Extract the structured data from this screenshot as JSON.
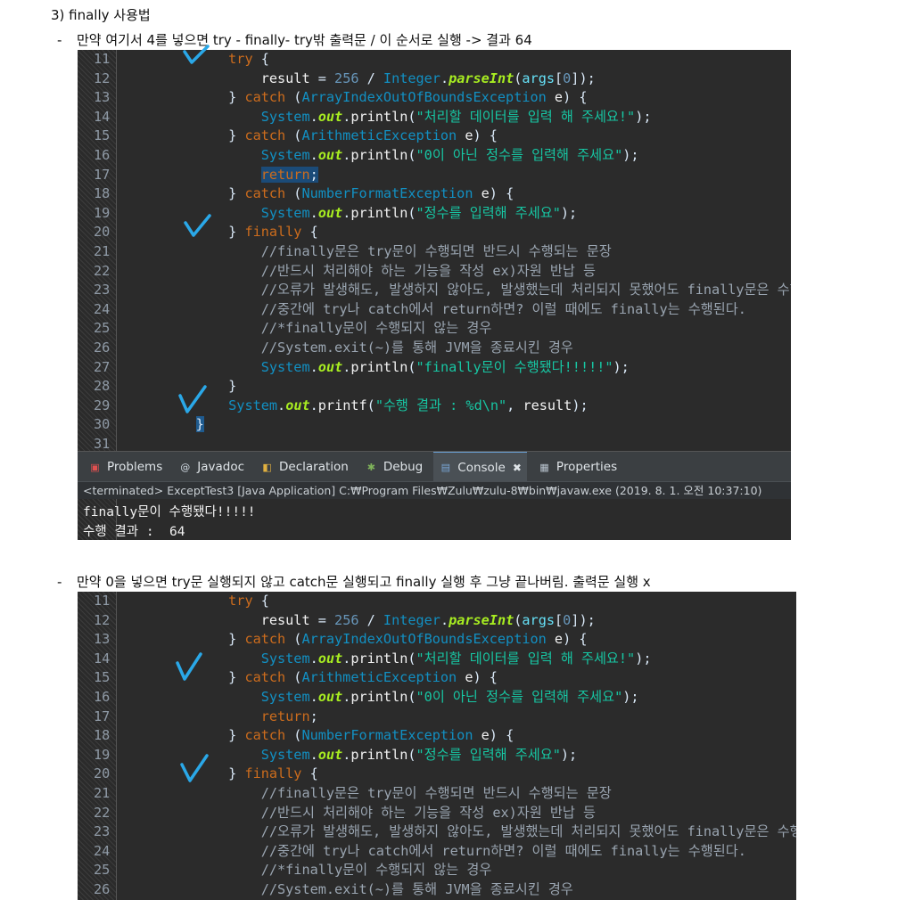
{
  "heading": "3)   finally 사용법",
  "bullet1": "만약 여기서 4를 넣으면 try - finally- try밖 출력문 / 이 순서로 실행 -> 결과 64",
  "bullet2": "만약 0을 넣으면 try문 실행되지 않고 catch문 실행되고 finally 실행 후 그냥 끝나버림. 출력문 실행 x",
  "dash": "-",
  "panel1": {
    "line_numbers": [
      "11",
      "12",
      "13",
      "14",
      "15",
      "16",
      "17",
      "18",
      "19",
      "20",
      "21",
      "22",
      "23",
      "24",
      "25",
      "26",
      "27",
      "28",
      "29",
      "30",
      "31"
    ]
  },
  "panel2": {
    "line_numbers": [
      "11",
      "12",
      "13",
      "14",
      "15",
      "16",
      "17",
      "18",
      "19",
      "20",
      "21",
      "22",
      "23",
      "24",
      "25",
      "26"
    ]
  },
  "tabs": [
    {
      "label": "Problems",
      "icon": "problems-icon"
    },
    {
      "label": "Javadoc",
      "icon": "javadoc-icon"
    },
    {
      "label": "Declaration",
      "icon": "declaration-icon"
    },
    {
      "label": "Debug",
      "icon": "debug-icon"
    },
    {
      "label": "Console",
      "icon": "console-icon",
      "active": true
    },
    {
      "label": "Properties",
      "icon": "properties-icon"
    }
  ],
  "tab_close": "✖",
  "status": "<terminated> ExceptTest3 [Java Application] C:₩Program Files₩Zulu₩zulu-8₩bin₩javaw.exe (2019. 8. 1. 오전 10:37:10)",
  "console": {
    "line1": "finally문이 수행됐다!!!!!",
    "line2": "수행 결과 :  64"
  },
  "colors": {
    "editor_bg": "#2b2b2b",
    "check_mark": "#2aa8e8"
  }
}
